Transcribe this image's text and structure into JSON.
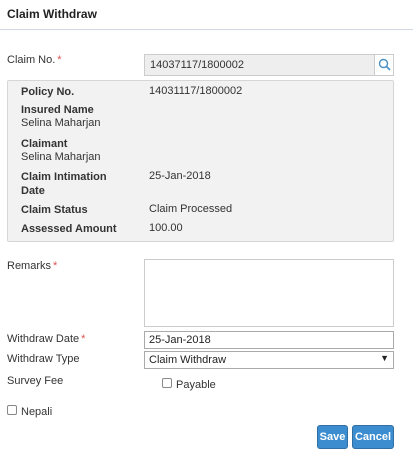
{
  "header": {
    "title": "Claim Withdraw"
  },
  "form": {
    "claim_no": {
      "label": "Claim No.",
      "required_mark": "*",
      "value": "14037117/1800002",
      "search_icon": "search-icon"
    },
    "details": {
      "policy_no": {
        "label": "Policy No.",
        "value": "14031117/1800002"
      },
      "insured_name": {
        "label": "Insured Name",
        "value": "Selina Maharjan"
      },
      "claimant": {
        "label": "Claimant",
        "value": "Selina Maharjan"
      },
      "claim_intimation_date": {
        "label_line1": "Claim Intimation",
        "label_line2": "Date",
        "value": "25-Jan-2018"
      },
      "claim_status": {
        "label": "Claim Status",
        "value": "Claim Processed"
      },
      "assessed_amount": {
        "label": "Assessed Amount",
        "value": "100.00"
      }
    },
    "remarks": {
      "label": "Remarks",
      "required_mark": "*",
      "value": ""
    },
    "withdraw_date": {
      "label": "Withdraw Date",
      "required_mark": "*",
      "value": "25-Jan-2018"
    },
    "withdraw_type": {
      "label": "Withdraw Type",
      "selected": "Claim Withdraw",
      "arrow_icon": "caret-down-icon"
    },
    "survey_fee": {
      "label": "Survey Fee",
      "checkbox_label": "Payable",
      "checked": false
    },
    "nepali": {
      "label": "Nepali",
      "checked": false
    }
  },
  "actions": {
    "save_label": "Save",
    "cancel_label": "Cancel"
  },
  "colors": {
    "primary_button": "#3c8dcf",
    "required": "#d9534f",
    "panel_bg": "#f2f2f2",
    "readonly_bg": "#eeeeee"
  }
}
